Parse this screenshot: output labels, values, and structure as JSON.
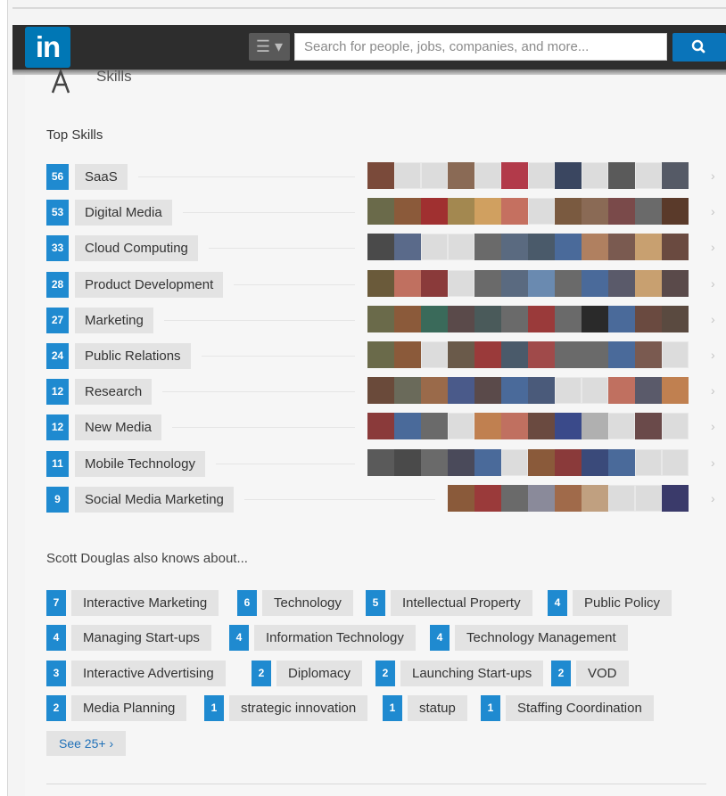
{
  "header": {
    "logo": "in",
    "search_placeholder": "Search for people, jobs, companies, and more...",
    "colors": {
      "brand": "#0077b5",
      "bar": "#2d2d2d",
      "search_button": "#0a74ba"
    }
  },
  "section": {
    "title": "Skills",
    "icon": "skills-icon"
  },
  "top_skills": {
    "title": "Top Skills",
    "items": [
      {
        "count": "56",
        "name": "SaaS"
      },
      {
        "count": "53",
        "name": "Digital Media"
      },
      {
        "count": "33",
        "name": "Cloud Computing"
      },
      {
        "count": "28",
        "name": "Product Development"
      },
      {
        "count": "27",
        "name": "Marketing"
      },
      {
        "count": "24",
        "name": "Public Relations"
      },
      {
        "count": "12",
        "name": "Research"
      },
      {
        "count": "12",
        "name": "New Media"
      },
      {
        "count": "11",
        "name": "Mobile Technology"
      },
      {
        "count": "9",
        "name": "Social Media Marketing"
      }
    ]
  },
  "also_knows": {
    "title": "Scott Douglas also knows about...",
    "items": [
      {
        "count": "7",
        "name": "Interactive Marketing"
      },
      {
        "count": "6",
        "name": "Technology"
      },
      {
        "count": "5",
        "name": "Intellectual Property"
      },
      {
        "count": "4",
        "name": "Public Policy"
      },
      {
        "count": "4",
        "name": "Managing Start-ups"
      },
      {
        "count": "4",
        "name": "Information Technology"
      },
      {
        "count": "4",
        "name": "Technology Management"
      },
      {
        "count": "3",
        "name": "Interactive Advertising"
      },
      {
        "count": "2",
        "name": "Diplomacy"
      },
      {
        "count": "2",
        "name": "Launching Start-ups"
      },
      {
        "count": "2",
        "name": "VOD"
      },
      {
        "count": "2",
        "name": "Media Planning"
      },
      {
        "count": "1",
        "name": "strategic innovation"
      },
      {
        "count": "1",
        "name": "statup"
      },
      {
        "count": "1",
        "name": "Staffing Coordination"
      }
    ],
    "see_more": "See 25+ ›"
  }
}
